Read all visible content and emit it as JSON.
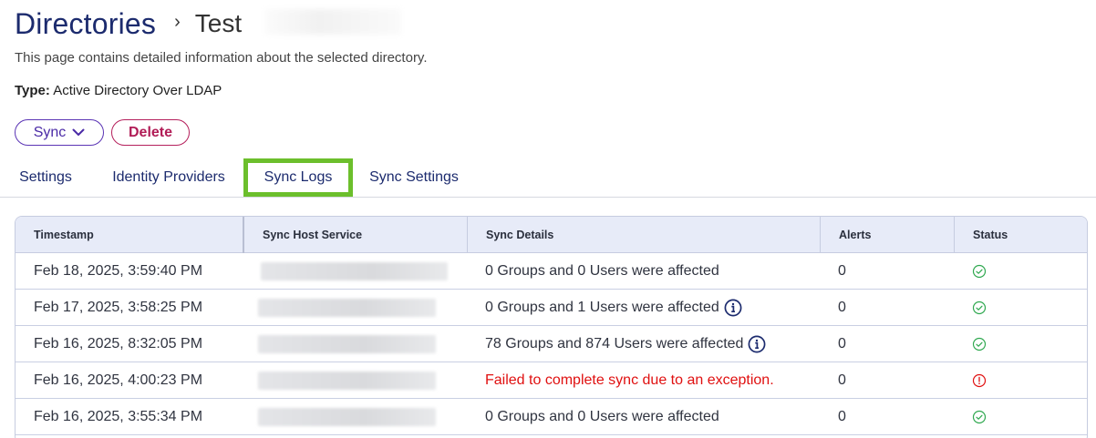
{
  "breadcrumb": {
    "root": "Directories",
    "separator": "›",
    "current": "Test"
  },
  "description": "This page contains detailed information about the selected directory.",
  "type": {
    "label": "Type:",
    "value": "Active Directory Over LDAP"
  },
  "actions": {
    "sync_label": "Sync",
    "delete_label": "Delete"
  },
  "tabs": [
    {
      "label": "Settings",
      "active": false
    },
    {
      "label": "Identity Providers",
      "active": false
    },
    {
      "label": "Sync Logs",
      "active": true
    },
    {
      "label": "Sync Settings",
      "active": false
    }
  ],
  "table": {
    "columns": [
      "Timestamp",
      "Sync Host Service",
      "Sync Details",
      "Alerts",
      "Status"
    ],
    "rows": [
      {
        "timestamp": "Feb 18, 2025, 3:59:40 PM",
        "details": "0 Groups and 0 Users were affected",
        "has_info": false,
        "alerts": "0",
        "status": "success"
      },
      {
        "timestamp": "Feb 17, 2025, 3:58:25 PM",
        "details": "0 Groups and 1 Users were affected",
        "has_info": true,
        "alerts": "0",
        "status": "success"
      },
      {
        "timestamp": "Feb 16, 2025, 8:32:05 PM",
        "details": "78 Groups and 874 Users were affected",
        "has_info": true,
        "alerts": "0",
        "status": "success"
      },
      {
        "timestamp": "Feb 16, 2025, 4:00:23 PM",
        "details": "Failed to complete sync due to an exception.",
        "has_info": false,
        "alerts": "0",
        "status": "error"
      },
      {
        "timestamp": "Feb 16, 2025, 3:55:34 PM",
        "details": "0 Groups and 0 Users were affected",
        "has_info": false,
        "alerts": "0",
        "status": "success"
      }
    ]
  },
  "colors": {
    "title": "#1c2b6e",
    "active_tab_outline": "#6cbf2c",
    "success": "#2fa84f",
    "error": "#e01010",
    "info": "#1c2b6e"
  },
  "icons": {
    "separator": "chevron-right-icon",
    "sync_dropdown": "chevron-down-icon",
    "success": "check-circle-icon",
    "error": "exclamation-circle-icon",
    "info": "info-circle-icon"
  }
}
